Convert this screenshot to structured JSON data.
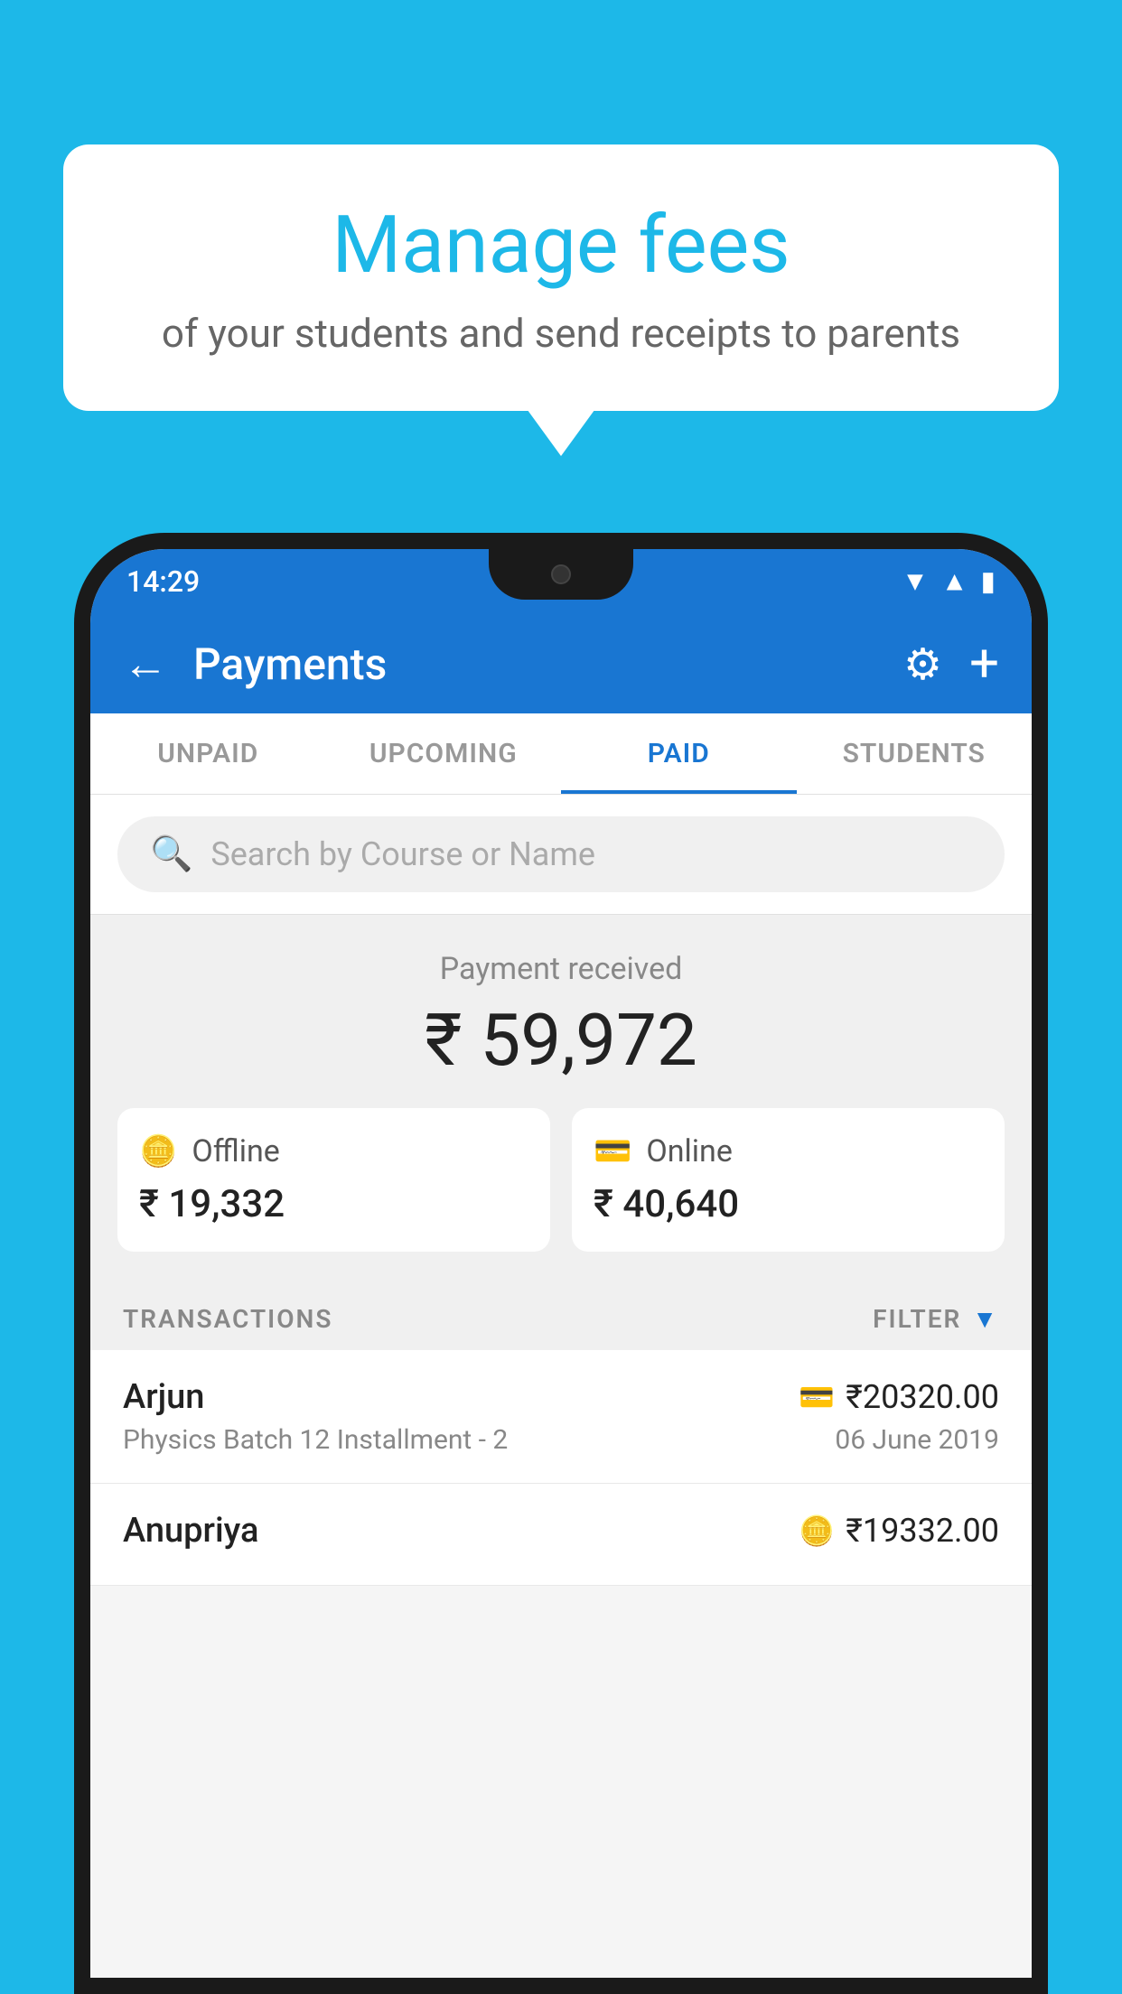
{
  "bubble": {
    "title": "Manage fees",
    "subtitle": "of your students and send receipts to parents"
  },
  "status_bar": {
    "time": "14:29"
  },
  "header": {
    "title": "Payments",
    "back_label": "←",
    "gear_label": "⚙",
    "plus_label": "+"
  },
  "tabs": [
    {
      "label": "UNPAID",
      "active": false
    },
    {
      "label": "UPCOMING",
      "active": false
    },
    {
      "label": "PAID",
      "active": true
    },
    {
      "label": "STUDENTS",
      "active": false
    }
  ],
  "search": {
    "placeholder": "Search by Course or Name"
  },
  "payment_summary": {
    "label": "Payment received",
    "amount": "₹ 59,972",
    "offline": {
      "label": "Offline",
      "amount": "₹ 19,332"
    },
    "online": {
      "label": "Online",
      "amount": "₹ 40,640"
    }
  },
  "transactions_section": {
    "label": "TRANSACTIONS",
    "filter_label": "FILTER"
  },
  "transactions": [
    {
      "name": "Arjun",
      "course": "Physics Batch 12 Installment - 2",
      "amount": "₹20320.00",
      "date": "06 June 2019",
      "payment_type": "online"
    },
    {
      "name": "Anupriya",
      "course": "",
      "amount": "₹19332.00",
      "date": "",
      "payment_type": "offline"
    }
  ],
  "colors": {
    "primary": "#1976D2",
    "background": "#1DB8E8",
    "accent": "#1DB8E8"
  }
}
